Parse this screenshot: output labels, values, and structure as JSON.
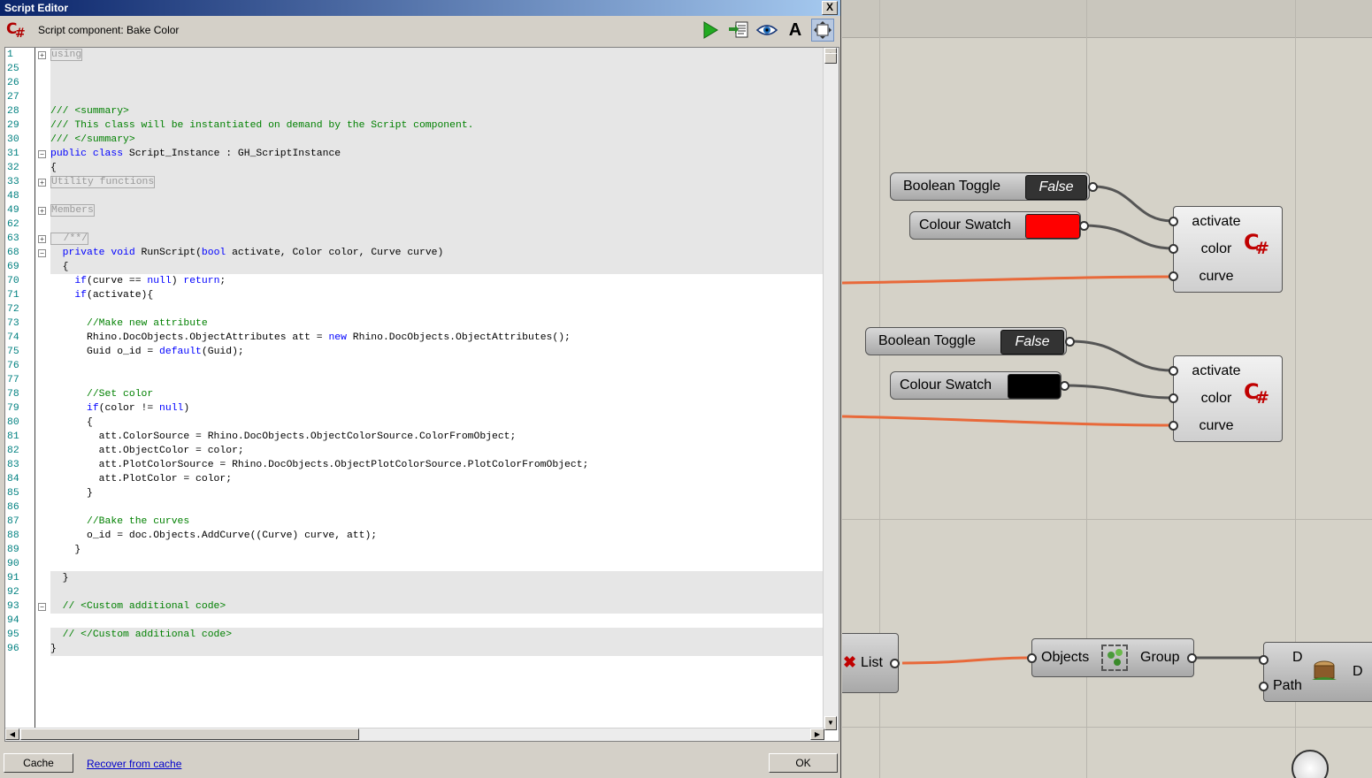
{
  "window": {
    "title": "Script Editor",
    "close_label": "X"
  },
  "header": {
    "component_title": "Script component: Bake Color",
    "font_button": "A"
  },
  "code_lines": [
    {
      "n": "1",
      "text": "using",
      "bg": "g",
      "fold": "+",
      "folded": true
    },
    {
      "n": "25",
      "text": "",
      "bg": "g"
    },
    {
      "n": "26",
      "text": "",
      "bg": "g"
    },
    {
      "n": "27",
      "text": "",
      "bg": "g"
    },
    {
      "n": "28",
      "text": "/// <summary>",
      "bg": "g",
      "kind": "cm"
    },
    {
      "n": "29",
      "text": "/// This class will be instantiated on demand by the Script component.",
      "bg": "g",
      "kind": "cm"
    },
    {
      "n": "30",
      "text": "/// </summary>",
      "bg": "g",
      "kind": "cm"
    },
    {
      "n": "31",
      "text": "public class Script_Instance : GH_ScriptInstance",
      "bg": "g",
      "fold": "-",
      "kwprefix": "public class "
    },
    {
      "n": "32",
      "text": "{",
      "bg": "g"
    },
    {
      "n": "33",
      "text": "Utility functions",
      "bg": "g",
      "fold": "+",
      "folded": true
    },
    {
      "n": "48",
      "text": "",
      "bg": "g"
    },
    {
      "n": "49",
      "text": "Members",
      "bg": "g",
      "fold": "+",
      "folded": true
    },
    {
      "n": "62",
      "text": "",
      "bg": "g"
    },
    {
      "n": "63",
      "text": "  /**/",
      "bg": "g",
      "fold": "+",
      "folded": true
    },
    {
      "n": "68",
      "text": "  private void RunScript(bool activate, Color color, Curve curve)",
      "bg": "g",
      "fold": "-"
    },
    {
      "n": "69",
      "text": "  {",
      "bg": "g"
    },
    {
      "n": "70",
      "text": "    if(curve == null) return;",
      "bg": "w"
    },
    {
      "n": "71",
      "text": "    if(activate){",
      "bg": "w"
    },
    {
      "n": "72",
      "text": "",
      "bg": "w"
    },
    {
      "n": "73",
      "text": "      //Make new attribute",
      "bg": "w",
      "kind": "cm"
    },
    {
      "n": "74",
      "text": "      Rhino.DocObjects.ObjectAttributes att = new Rhino.DocObjects.ObjectAttributes();",
      "bg": "w"
    },
    {
      "n": "75",
      "text": "      Guid o_id = default(Guid);",
      "bg": "w"
    },
    {
      "n": "76",
      "text": "",
      "bg": "w"
    },
    {
      "n": "77",
      "text": "",
      "bg": "w"
    },
    {
      "n": "78",
      "text": "      //Set color",
      "bg": "w",
      "kind": "cm"
    },
    {
      "n": "79",
      "text": "      if(color != null)",
      "bg": "w"
    },
    {
      "n": "80",
      "text": "      {",
      "bg": "w"
    },
    {
      "n": "81",
      "text": "        att.ColorSource = Rhino.DocObjects.ObjectColorSource.ColorFromObject;",
      "bg": "w"
    },
    {
      "n": "82",
      "text": "        att.ObjectColor = color;",
      "bg": "w"
    },
    {
      "n": "83",
      "text": "        att.PlotColorSource = Rhino.DocObjects.ObjectPlotColorSource.PlotColorFromObject;",
      "bg": "w"
    },
    {
      "n": "84",
      "text": "        att.PlotColor = color;",
      "bg": "w"
    },
    {
      "n": "85",
      "text": "      }",
      "bg": "w"
    },
    {
      "n": "86",
      "text": "",
      "bg": "w"
    },
    {
      "n": "87",
      "text": "      //Bake the curves",
      "bg": "w",
      "kind": "cm"
    },
    {
      "n": "88",
      "text": "      o_id = doc.Objects.AddCurve((Curve) curve, att);",
      "bg": "w"
    },
    {
      "n": "89",
      "text": "    }",
      "bg": "w"
    },
    {
      "n": "90",
      "text": "",
      "bg": "w"
    },
    {
      "n": "91",
      "text": "  }",
      "bg": "g"
    },
    {
      "n": "92",
      "text": "",
      "bg": "g"
    },
    {
      "n": "93",
      "text": "  // <Custom additional code>",
      "bg": "g",
      "kind": "cm",
      "fold": "-"
    },
    {
      "n": "94",
      "text": "",
      "bg": "w"
    },
    {
      "n": "95",
      "text": "  // </Custom additional code>",
      "bg": "g",
      "kind": "cm"
    },
    {
      "n": "96",
      "text": "}",
      "bg": "g"
    }
  ],
  "footer": {
    "cache_label": "Cache",
    "recover_label": "Recover from cache",
    "ok_label": "OK"
  },
  "canvas": {
    "group1": {
      "toggle": {
        "label": "Boolean Toggle",
        "value": "False"
      },
      "swatch": {
        "label": "Colour Swatch",
        "color": "#ff0000"
      },
      "component": {
        "inputs": [
          "activate",
          "color",
          "curve"
        ]
      }
    },
    "group2": {
      "toggle": {
        "label": "Boolean Toggle",
        "value": "False"
      },
      "swatch": {
        "label": "Colour Swatch",
        "color": "#000000"
      },
      "component": {
        "inputs": [
          "activate",
          "color",
          "curve"
        ]
      }
    },
    "list_node": {
      "label": "List"
    },
    "group_node": {
      "left": "Objects",
      "right": "Group"
    },
    "data_node": {
      "in_top": "D",
      "in_bottom": "Path",
      "out": "D"
    },
    "wire_color": "#e8693a"
  }
}
